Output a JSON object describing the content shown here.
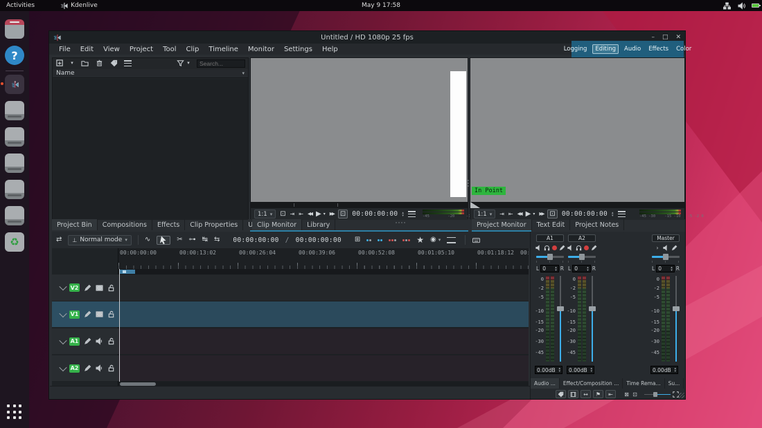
{
  "desktop": {
    "topbar": {
      "activities": "Activities",
      "app_name": "Kdenlive",
      "clock": "May 9  17:58"
    },
    "dock": {
      "items": [
        "files",
        "help",
        "kdenlive",
        "window-1",
        "window-2",
        "window-3",
        "window-4",
        "window-5",
        "trash"
      ],
      "help_glyph": "?",
      "trash_glyph": "♻"
    }
  },
  "window": {
    "title": "Untitled / HD 1080p 25 fps",
    "controls": {
      "minimize": "–",
      "maximize": "□",
      "close": "✕"
    },
    "menus": [
      "File",
      "Edit",
      "View",
      "Project",
      "Tool",
      "Clip",
      "Timeline",
      "Monitor",
      "Settings",
      "Help"
    ],
    "workspaces": [
      "Logging",
      "Editing",
      "Audio",
      "Effects",
      "Color"
    ]
  },
  "bin": {
    "search_placeholder": "Search...",
    "name_column": "Name",
    "tabs": [
      "Project Bin",
      "Compositions",
      "Effects",
      "Clip Properties",
      "Undo History"
    ]
  },
  "clip_monitor": {
    "zoom": "1:1",
    "timecode": "00:00:00:00",
    "meter_labels": "-45        -20     -10   -5",
    "tabs": [
      "Clip Monitor",
      "Library"
    ]
  },
  "project_monitor": {
    "zoom": "1:1",
    "timecode": "00:00:00:00",
    "in_point": "In Point",
    "meter_labels": "-45 -30    -15 -10   -5 -2 0",
    "tabs": [
      "Project Monitor",
      "Text Edit",
      "Project Notes"
    ]
  },
  "timeline": {
    "mode": "Normal mode",
    "position": "00:00:00:00",
    "separator": "/",
    "duration": "00:00:00:00",
    "ruler": [
      "00:00:00:00",
      "00:00:13:02",
      "00:00:26:04",
      "00:00:39:06",
      "00:00:52:08",
      "00:01:05:10",
      "00:01:18:12",
      "00:0"
    ],
    "tracks": [
      {
        "id": "V2"
      },
      {
        "id": "V1"
      },
      {
        "id": "A1"
      },
      {
        "id": "A2"
      }
    ]
  },
  "mixer": {
    "channels": [
      "A1",
      "A2",
      "Master"
    ],
    "scale": [
      "0",
      "-2",
      "-5",
      "-10",
      "-15",
      "-20",
      "-30",
      "-45"
    ],
    "pan_left": "L",
    "pan_value": "0",
    "pan_right": "R",
    "gain": "0.00dB",
    "tabs": [
      "Audio ...",
      "Effect/Composition ...",
      "Time Rema...",
      "Su..."
    ]
  }
}
